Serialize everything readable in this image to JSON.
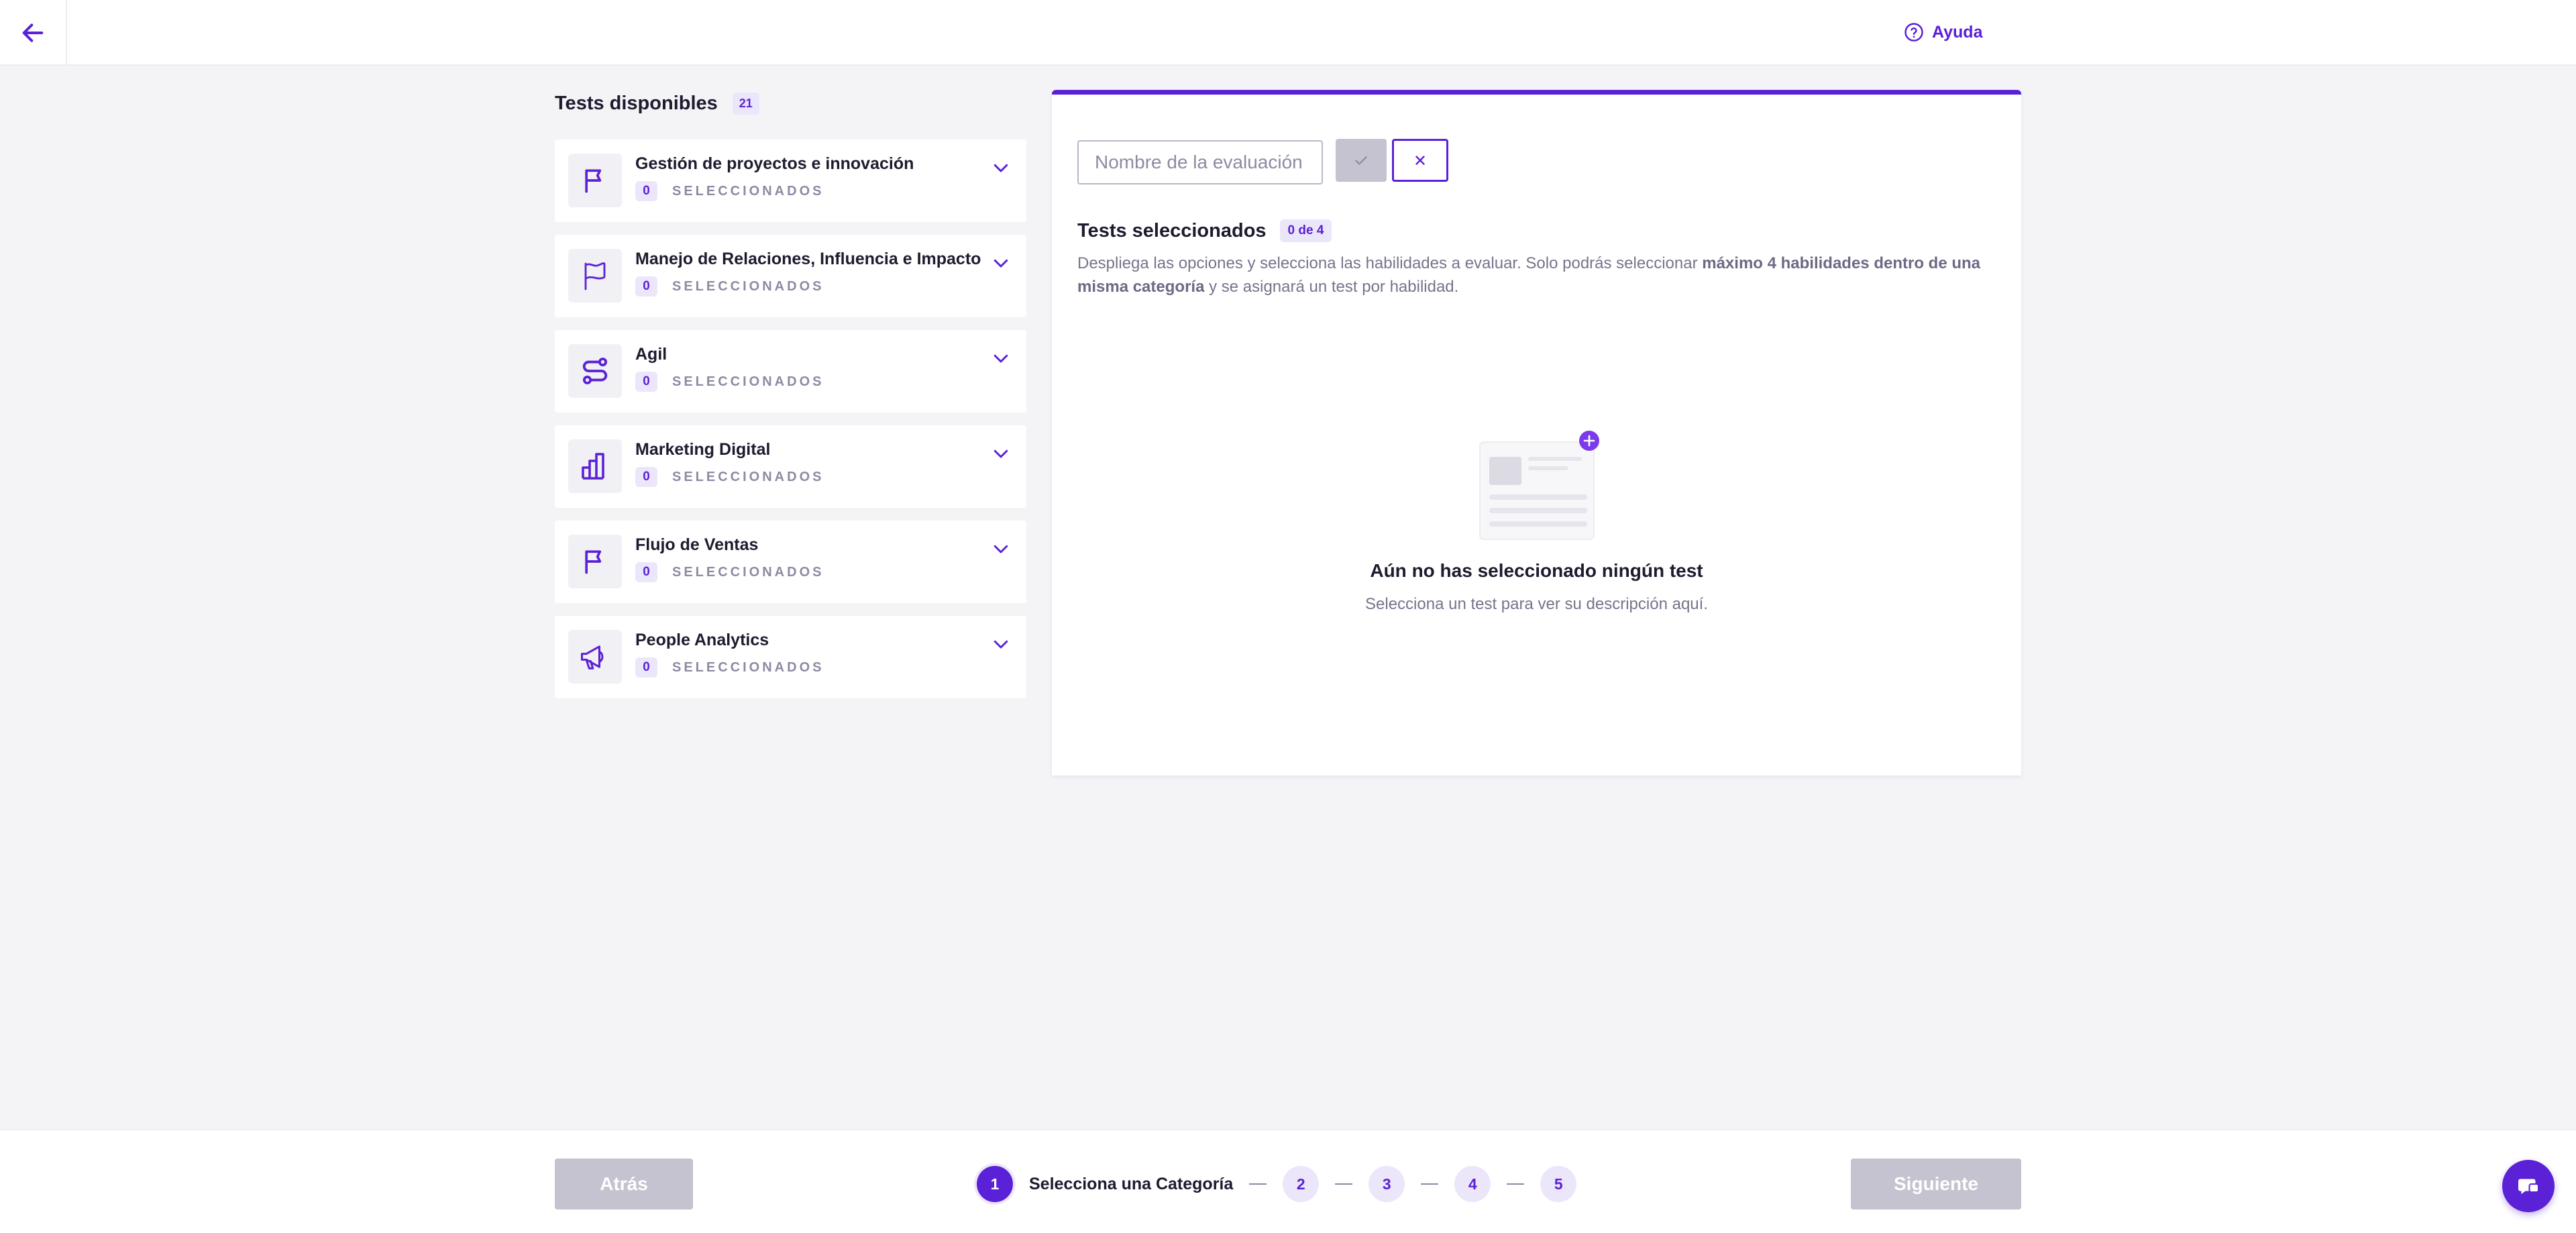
{
  "header": {
    "back_icon": "arrow-left-icon",
    "help_label": "Ayuda",
    "help_icon": "question-circle-icon"
  },
  "sidebar": {
    "title": "Tests disponibles",
    "count": "21",
    "categories": [
      {
        "name": "Gestión de proyectos e innovación",
        "selected": "0",
        "selected_label": "SELECCIONADOS",
        "icon": "flag-icon"
      },
      {
        "name": "Manejo de Relaciones, Influencia e Impacto",
        "selected": "0",
        "selected_label": "SELECCIONADOS",
        "icon": "flag-outline-icon"
      },
      {
        "name": "Agil",
        "selected": "0",
        "selected_label": "SELECCIONADOS",
        "icon": "route-icon"
      },
      {
        "name": "Marketing Digital",
        "selected": "0",
        "selected_label": "SELECCIONADOS",
        "icon": "bar-chart-icon"
      },
      {
        "name": "Flujo de Ventas",
        "selected": "0",
        "selected_label": "SELECCIONADOS",
        "icon": "flag-icon"
      },
      {
        "name": "People Analytics",
        "selected": "0",
        "selected_label": "SELECCIONADOS",
        "icon": "megaphone-icon"
      }
    ]
  },
  "panel": {
    "name_placeholder": "Nombre de la evaluación",
    "name_value": "",
    "selected_title": "Tests seleccionados",
    "selected_count": "0 de 4",
    "instructions_1": "Despliega las opciones y selecciona las habilidades a evaluar. Solo podrás seleccionar ",
    "instructions_bold_1": "máximo 4 habilidades dentro de una misma categoría",
    "instructions_2": " y se asignará un test por habilidad.",
    "empty_title": "Aún no has seleccionado ningún test",
    "empty_subtitle": "Selecciona un test para ver su descripción aquí."
  },
  "footer": {
    "back_label": "Atrás",
    "next_label": "Siguiente",
    "steps": [
      {
        "number": "1",
        "label": "Selecciona una Categoría",
        "active": true
      },
      {
        "number": "2"
      },
      {
        "number": "3"
      },
      {
        "number": "4"
      },
      {
        "number": "5"
      }
    ]
  },
  "colors": {
    "brand": "#5b21d6",
    "brand_light": "#ece6fb",
    "disabled": "#c4c3cf",
    "background": "#f4f4f7"
  }
}
